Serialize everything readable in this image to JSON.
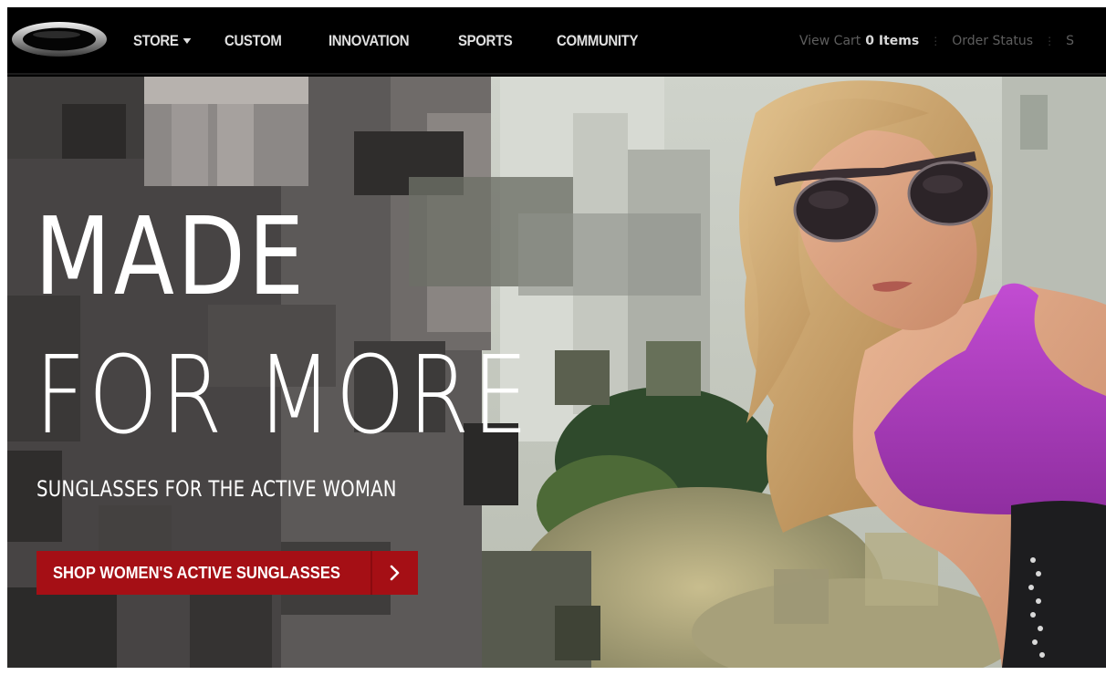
{
  "nav": {
    "logo_name": "brand-ellipse-logo",
    "items": [
      {
        "label": "STORE"
      },
      {
        "label": "CUSTOM"
      },
      {
        "label": "INNOVATION"
      },
      {
        "label": "SPORTS"
      },
      {
        "label": "COMMUNITY"
      }
    ],
    "utility": {
      "view_cart": "View Cart",
      "cart_count": "0 Items",
      "order_status": "Order Status",
      "truncated": "S"
    }
  },
  "hero": {
    "headline_line1": "MADE",
    "headline_line2": "FOR MORE",
    "subheadline": "SUNGLASSES FOR THE ACTIVE WOMAN",
    "cta_label": "SHOP WOMEN'S ACTIVE SUNGLASSES",
    "cta_icon": "chevron-right-icon"
  },
  "colors": {
    "nav_bg": "#000000",
    "cta_red": "#a50f15",
    "top_magenta": "#a53ab4"
  }
}
